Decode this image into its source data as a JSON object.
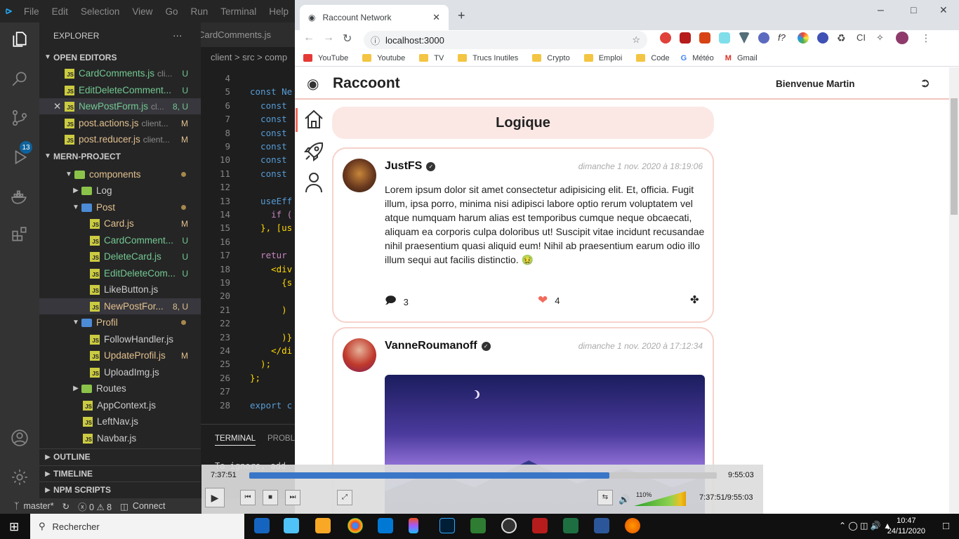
{
  "vscode": {
    "menu": [
      "File",
      "Edit",
      "Selection",
      "View",
      "Go",
      "Run",
      "Terminal",
      "Help"
    ],
    "explorer_title": "EXPLORER",
    "scm_badge": "13",
    "open_editors": {
      "title": "OPEN EDITORS",
      "files": [
        {
          "name": "CardComments.js",
          "path": "cli...",
          "status": "U"
        },
        {
          "name": "EditDeleteComment...",
          "path": "",
          "status": "U"
        },
        {
          "name": "NewPostForm.js",
          "path": "cl...",
          "status": "8, U"
        },
        {
          "name": "post.actions.js",
          "path": "client...",
          "status": "M"
        },
        {
          "name": "post.reducer.js",
          "path": "client...",
          "status": "M"
        }
      ]
    },
    "project": {
      "title": "MERN-PROJECT",
      "tree": [
        {
          "name": "components",
          "kind": "folder"
        },
        {
          "name": "Log",
          "kind": "folder"
        },
        {
          "name": "Post",
          "kind": "folder"
        },
        {
          "name": "Card.js",
          "status": "M"
        },
        {
          "name": "CardComment...",
          "status": "U"
        },
        {
          "name": "DeleteCard.js",
          "status": "U"
        },
        {
          "name": "EditDeleteCom...",
          "status": "U"
        },
        {
          "name": "LikeButton.js",
          "status": ""
        },
        {
          "name": "NewPostFor...",
          "status": "8, U"
        },
        {
          "name": "Profil",
          "kind": "folder"
        },
        {
          "name": "FollowHandler.js",
          "status": ""
        },
        {
          "name": "UpdateProfil.js",
          "status": "M"
        },
        {
          "name": "UploadImg.js",
          "status": ""
        },
        {
          "name": "Routes",
          "kind": "folder"
        },
        {
          "name": "AppContext.js",
          "status": ""
        },
        {
          "name": "LeftNav.js",
          "status": ""
        },
        {
          "name": "Navbar.js",
          "status": ""
        }
      ]
    },
    "outline": "OUTLINE",
    "timeline": "TIMELINE",
    "npm_scripts": "NPM SCRIPTS",
    "editor_tab": "CardComments.js",
    "breadcrumb": "client > src > comp",
    "line_numbers": [
      "4",
      "5",
      "6",
      "7",
      "8",
      "9",
      "10",
      "11",
      "12",
      "13",
      "14",
      "15",
      "16",
      "17",
      "18",
      "19",
      "20",
      "21",
      "22",
      "23",
      "24",
      "25",
      "26",
      "27",
      "28"
    ],
    "code_lines": [
      "",
      "const Ne",
      "  const",
      "  const",
      "  const",
      "  const",
      "  const",
      "  const",
      "",
      "  useEff",
      "    if (",
      "  }, [us",
      "",
      "  retur",
      "    <div",
      "      {s",
      "",
      "      )",
      "",
      "      )}",
      "    </di",
      "  );",
      "};",
      "",
      "export c"
    ],
    "terminal_tabs": [
      "TERMINAL",
      "PROBL"
    ],
    "terminal_text": "To ignore, add",
    "status": {
      "branch": "master*",
      "problems": "ⓧ 0 ⚠ 8",
      "connect": "Connect"
    }
  },
  "chrome": {
    "tab_title": "Raccount Network",
    "url": "localhost:3000",
    "bookmarks": [
      "YouTube",
      "Youtube",
      "TV",
      "Trucs Inutiles",
      "Crypto",
      "Emploi",
      "Code",
      "Météo",
      "Gmail"
    ]
  },
  "app": {
    "brand": "Raccoont",
    "welcome": "Bienvenue Martin",
    "thread_title": "Logique",
    "posts": [
      {
        "author": "JustFS",
        "date": "dimanche 1 nov. 2020 à 18:19:06",
        "message": "Lorem ipsum dolor sit amet consectetur adipisicing elit. Et, officia. Fugit illum, ipsa porro, minima nisi adipisci labore optio rerum voluptatem vel atque numquam harum alias est temporibus cumque neque obcaecati, aliquam ea corporis culpa doloribus ut! Suscipit vitae incidunt recusandae nihil praesentium quasi aliquid eum! Nihil ab praesentium earum odio illo illum sequi aut facilis distinctio. 🤢",
        "comments": "3",
        "likes": "4"
      },
      {
        "author": "VanneRoumanoff",
        "date": "dimanche 1 nov. 2020 à 17:12:34"
      }
    ]
  },
  "player": {
    "elapsed": "7:37:51",
    "total": "9:55:03",
    "progress": 0.77,
    "volume": "110%",
    "time_readout": "7:37:51/9:55:03"
  },
  "taskbar": {
    "search_placeholder": "Rechercher",
    "time": "10:47",
    "date": "24/11/2020"
  }
}
